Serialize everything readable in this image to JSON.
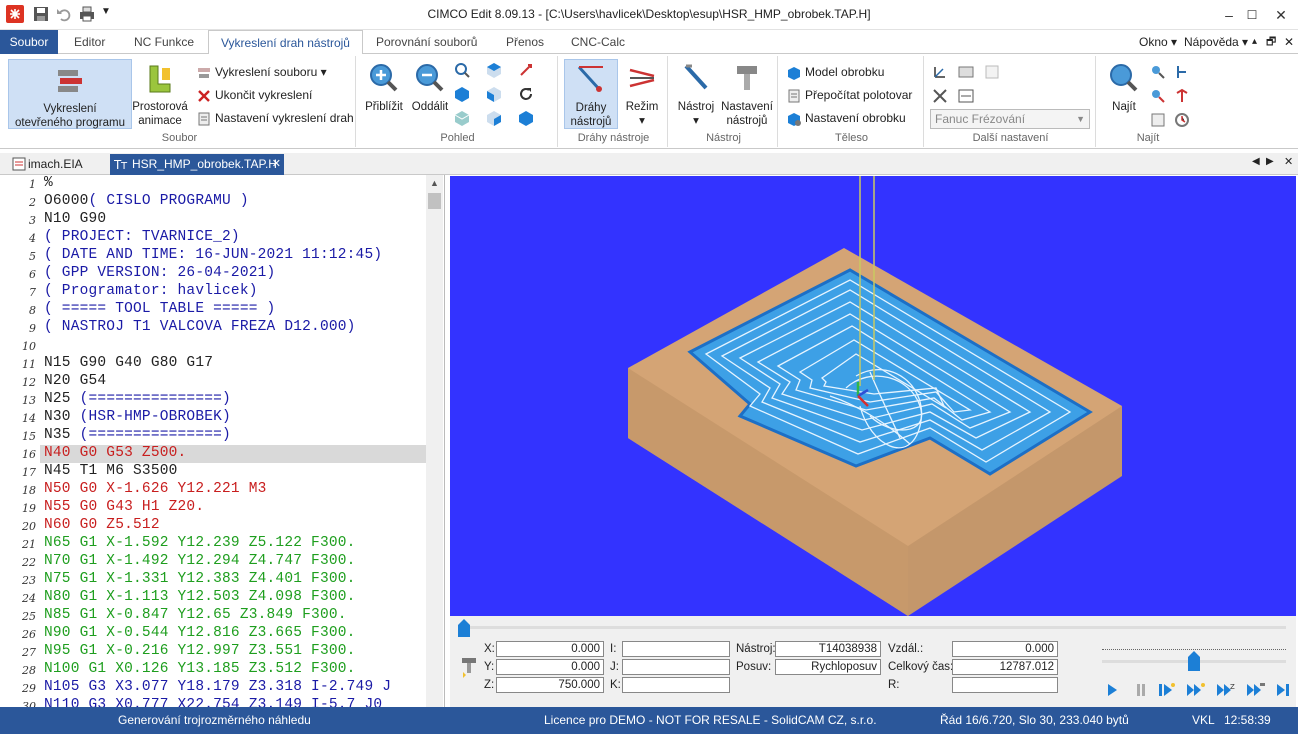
{
  "app": {
    "title": "CIMCO Edit 8.09.13 - [C:\\Users\\havlicek\\Desktop\\esup\\HSR_HMP_obrobek.TAP.H]",
    "window_min": "–",
    "window_max": "☐",
    "window_close": "✕"
  },
  "menu": {
    "tabs": [
      "Soubor",
      "Editor",
      "NC Funkce",
      "Vykreslení drah nástrojů",
      "Porovnání souborů",
      "Přenos",
      "CNC-Calc"
    ],
    "right": [
      "Okno",
      "Nápověda"
    ]
  },
  "ribbon": {
    "soubor": {
      "big1": "Vykreslení otevřeného programu",
      "big1_l1": "Vykreslení",
      "big1_l2": "otevřeného programu",
      "big2_l1": "Prostorová",
      "big2_l2": "animace",
      "small1": "Vykreslení souboru",
      "small2": "Ukončit vykreslení",
      "small3": "Nastavení vykreslení drah",
      "label": "Soubor"
    },
    "pohled": {
      "zoom_in": "Přiblížit",
      "zoom_out": "Oddálit",
      "label": "Pohled"
    },
    "drahy": {
      "btn1_l1": "Dráhy",
      "btn1_l2": "nástrojů",
      "btn2": "Režim",
      "label": "Dráhy nástroje"
    },
    "nastroj": {
      "btn1": "Nástroj",
      "btn2_l1": "Nastavení",
      "btn2_l2": "nástrojů",
      "label": "Nástroj"
    },
    "teleso": {
      "small1": "Model obrobku",
      "small2": "Přepočítat polotovar",
      "small3": "Nastavení obrobku",
      "label": "Těleso"
    },
    "dalsi": {
      "combo": "Fanuc Frézování",
      "label": "Další nastavení"
    },
    "najit": {
      "btn": "Najít",
      "label": "Najít"
    }
  },
  "doctabs": [
    "imach.EIA",
    "HSR_HMP_obrobek.TAP.H"
  ],
  "editor": {
    "lines": [
      {
        "n": "1",
        "t": "%",
        "c": "#222"
      },
      {
        "n": "2",
        "t": "O6000( CISLO PROGRAMU )",
        "c": "#222",
        "c2": "#1a1aa6",
        "split": 5
      },
      {
        "n": "3",
        "t": "N10 G90",
        "c": "#222"
      },
      {
        "n": "4",
        "t": "( PROJECT: TVARNICE_2)",
        "c": "#1a1aa6"
      },
      {
        "n": "5",
        "t": "( DATE AND TIME: 16-JUN-2021 11:12:45)",
        "c": "#1a1aa6"
      },
      {
        "n": "6",
        "t": "( GPP VERSION: 26-04-2021)",
        "c": "#1a1aa6"
      },
      {
        "n": "7",
        "t": "( Programator: havlicek)",
        "c": "#1a1aa6"
      },
      {
        "n": "8",
        "t": "( ===== TOOL TABLE ===== )",
        "c": "#1a1aa6"
      },
      {
        "n": "9",
        "t": "( NASTROJ T1 VALCOVA FREZA D12.000)",
        "c": "#1a1aa6"
      },
      {
        "n": "10",
        "t": "",
        "c": "#222"
      },
      {
        "n": "11",
        "t": "N15 G90 G40 G80 G17",
        "c": "#222"
      },
      {
        "n": "12",
        "t": "N20 G54",
        "c": "#222"
      },
      {
        "n": "13",
        "t": "N25 (===============)",
        "c": "#222",
        "c2": "#1a1aa6",
        "split": 4
      },
      {
        "n": "14",
        "t": "N30 (HSR-HMP-OBROBEK)",
        "c": "#222",
        "c2": "#1a1aa6",
        "split": 4
      },
      {
        "n": "15",
        "t": "N35 (===============)",
        "c": "#222",
        "c2": "#1a1aa6",
        "split": 4
      },
      {
        "n": "16",
        "t": "N40 G0 G53 Z500.",
        "c": "#c81e1e"
      },
      {
        "n": "17",
        "t": "N45 T1 M6 S3500",
        "c": "#222"
      },
      {
        "n": "18",
        "t": "N50 G0 X-1.626 Y12.221 M3",
        "c": "#c81e1e"
      },
      {
        "n": "19",
        "t": "N55 G0 G43 H1 Z20.",
        "c": "#c81e1e"
      },
      {
        "n": "20",
        "t": "N60 G0 Z5.512",
        "c": "#c81e1e"
      },
      {
        "n": "21",
        "t": "N65 G1 X-1.592 Y12.239 Z5.122 F300.",
        "c": "#1e9e1e"
      },
      {
        "n": "22",
        "t": "N70 G1 X-1.492 Y12.294 Z4.747 F300.",
        "c": "#1e9e1e"
      },
      {
        "n": "23",
        "t": "N75 G1 X-1.331 Y12.383 Z4.401 F300.",
        "c": "#1e9e1e"
      },
      {
        "n": "24",
        "t": "N80 G1 X-1.113 Y12.503 Z4.098 F300.",
        "c": "#1e9e1e"
      },
      {
        "n": "25",
        "t": "N85 G1 X-0.847 Y12.65 Z3.849 F300.",
        "c": "#1e9e1e"
      },
      {
        "n": "26",
        "t": "N90 G1 X-0.544 Y12.816 Z3.665 F300.",
        "c": "#1e9e1e"
      },
      {
        "n": "27",
        "t": "N95 G1 X-0.216 Y12.997 Z3.551 F300.",
        "c": "#1e9e1e"
      },
      {
        "n": "28",
        "t": "N100 G1 X0.126 Y13.185 Z3.512 F300.",
        "c": "#1e9e1e"
      },
      {
        "n": "29",
        "t": "N105 G3 X3.077 Y18.179 Z3.318 I-2.749 J",
        "c": "#1a1aa6"
      },
      {
        "n": "30",
        "t": "N110 G3 X0.777 X22.754 Z3.149 I-5.7 J0",
        "c": "#1a1aa6"
      }
    ],
    "highlight_line": "16"
  },
  "controls": {
    "x_label": "X:",
    "x_val": "0.000",
    "y_label": "Y:",
    "y_val": "0.000",
    "z_label": "Z:",
    "z_val": "750.000",
    "i_label": "I:",
    "j_label": "J:",
    "k_label": "K:",
    "tool_label": "Nástroj:",
    "tool_val": "T14038938",
    "feed_label": "Posuv:",
    "feed_val": "Rychloposuv",
    "dist_label": "Vzdál.:",
    "dist_val": "0.000",
    "time_label": "Celkový čas:",
    "time_val": "12787.012",
    "r_label": "R:",
    "timeline_progress": 0.0,
    "speed_level": 0.5
  },
  "status": {
    "left": "Generování trojrozměrného náhledu",
    "center": "Licence pro DEMO - NOT FOR RESALE - SolidCAM CZ, s.r.o.",
    "position": "Řád 16/6.720, Slo 30, 233.040 bytů",
    "mode": "VKL",
    "time": "12:58:39"
  },
  "colors": {
    "accent": "#2b579a",
    "viewport_bg": "#3333ff",
    "stock": "#d4a475",
    "pocket": "#3da0e6"
  }
}
